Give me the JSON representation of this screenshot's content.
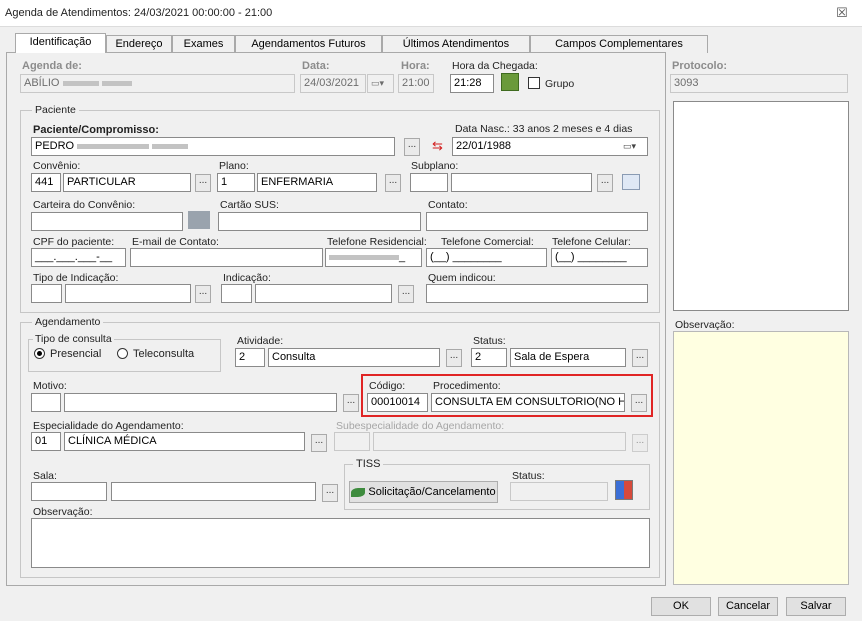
{
  "window": {
    "title": "Agenda de Atendimentos: 24/03/2021 00:00:00 - 21:00",
    "close": "☒"
  },
  "tabs": [
    {
      "label": "Identificação"
    },
    {
      "label": "Endereço"
    },
    {
      "label": "Exames"
    },
    {
      "label": "Agendamentos Futuros"
    },
    {
      "label": "Últimos Atendimentos"
    },
    {
      "label": "Campos Complementares"
    }
  ],
  "header": {
    "agenda_label": "Agenda de:",
    "agenda_value": "ABÍLIO",
    "data_label": "Data:",
    "data_value": "24/03/2021",
    "hora_label": "Hora:",
    "hora_value": "21:00",
    "chegada_label": "Hora da Chegada:",
    "chegada_value": "21:28",
    "grupo_label": "Grupo",
    "protocolo_label": "Protocolo:",
    "protocolo_value": "3093"
  },
  "paciente": {
    "group_label": "Paciente",
    "paciente_label": "Paciente/Compromisso:",
    "paciente_value": "PEDRO",
    "nasc_label": "Data Nasc.: 33 anos 2 meses  e 4 dias",
    "nasc_value": "22/01/1988",
    "convenio_label": "Convênio:",
    "convenio_code": "441",
    "convenio_name": "PARTICULAR",
    "plano_label": "Plano:",
    "plano_code": "1",
    "plano_name": "ENFERMARIA",
    "subplano_label": "Subplano:",
    "carteira_label": "Carteira do Convênio:",
    "sus_label": "Cartão SUS:",
    "contato_label": "Contato:",
    "cpf_label": "CPF do paciente:",
    "cpf_mask": "___.___.___-__",
    "email_label": "E-mail de Contato:",
    "tel_res_label": "Telefone Residencial:",
    "tel_res_tail": "_",
    "tel_com_label": "Telefone Comercial:",
    "tel_com_mask": "(__) ________",
    "tel_cel_label": "Telefone Celular:",
    "tel_cel_mask": "(__) ________",
    "tipo_ind_label": "Tipo de Indicação:",
    "indicacao_label": "Indicação:",
    "quem_label": "Quem indicou:"
  },
  "agendamento": {
    "group_label": "Agendamento",
    "tipo_label": "Tipo de consulta",
    "presencial": "Presencial",
    "teleconsulta": "Teleconsulta",
    "atividade_label": "Atividade:",
    "atividade_code": "2",
    "atividade_name": "Consulta",
    "status_label": "Status:",
    "status_code": "2",
    "status_name": "Sala de Espera",
    "motivo_label": "Motivo:",
    "codigo_label": "Código:",
    "codigo_value": "00010014",
    "proc_label": "Procedimento:",
    "proc_value": "CONSULTA EM CONSULTORIO(NO HO",
    "esp_label": "Especialidade do Agendamento:",
    "esp_code": "01",
    "esp_name": "CLÍNICA MÉDICA",
    "subesp_label": "Subespecialidade do Agendamento:",
    "sala_label": "Sala:",
    "tiss_label": "TISS",
    "tiss_button": "Solicitação/Cancelamento",
    "tiss_status_label": "Status:",
    "obs_label": "Observação:"
  },
  "right": {
    "obs_label": "Observação:"
  },
  "footer": {
    "ok": "OK",
    "cancelar": "Cancelar",
    "salvar": "Salvar"
  },
  "colors": {
    "highlight": "#e02525",
    "obs_bg": "#ffffe1"
  }
}
